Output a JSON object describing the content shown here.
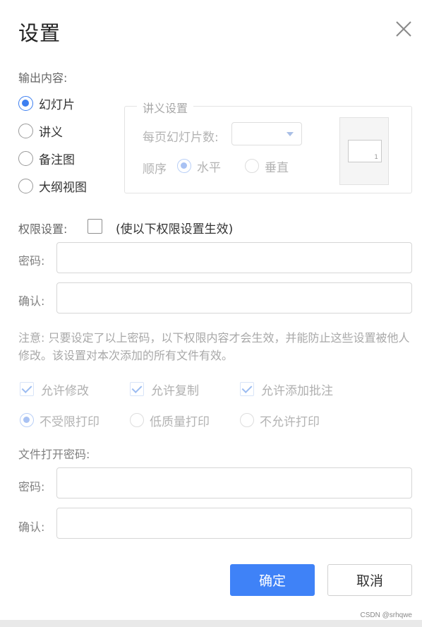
{
  "dialog": {
    "title": "设置",
    "close_icon": "close-icon"
  },
  "output": {
    "label": "输出内容:",
    "options": [
      {
        "label": "幻灯片",
        "checked": true
      },
      {
        "label": "讲义",
        "checked": false
      },
      {
        "label": "备注图",
        "checked": false
      },
      {
        "label": "大纲视图",
        "checked": false
      }
    ]
  },
  "handout": {
    "title": "讲义设置",
    "per_page_label": "每页幻灯片数:",
    "per_page_value": "",
    "order_label": "顺序",
    "order_options": [
      {
        "label": "水平",
        "checked": true
      },
      {
        "label": "垂直",
        "checked": false
      }
    ],
    "preview_number": "1"
  },
  "permission": {
    "label": "权限设置:",
    "checked": false,
    "note": "(使以下权限设置生效)",
    "password_label": "密码:",
    "password_value": "",
    "confirm_label": "确认:",
    "confirm_value": "",
    "notice": "注意: 只要设定了以上密码，以下权限内容才会生效，并能防止这些设置被他人修改。该设置对本次添加的所有文件有效。",
    "checks": [
      {
        "label": "允许修改",
        "checked": true
      },
      {
        "label": "允许复制",
        "checked": true
      },
      {
        "label": "允许添加批注",
        "checked": true
      }
    ],
    "print_options": [
      {
        "label": "不受限打印",
        "checked": true
      },
      {
        "label": "低质量打印",
        "checked": false
      },
      {
        "label": "不允许打印",
        "checked": false
      }
    ]
  },
  "file_open": {
    "label": "文件打开密码:",
    "password_label": "密码:",
    "password_value": "",
    "confirm_label": "确认:",
    "confirm_value": ""
  },
  "buttons": {
    "ok": "确定",
    "cancel": "取消"
  },
  "watermark": "CSDN @srhqwe",
  "colors": {
    "accent": "#3f82f7",
    "disabled_text": "#b0b0b0"
  }
}
